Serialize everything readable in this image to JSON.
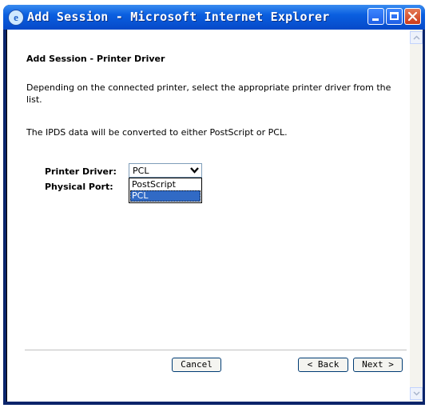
{
  "window": {
    "title": "Add Session - Microsoft Internet Explorer"
  },
  "page": {
    "heading": "Add Session - Printer Driver",
    "instruction": "Depending on the connected printer, select the appropriate printer driver from the list.",
    "conversion_note": "The IPDS data will be converted to either PostScript or PCL."
  },
  "form": {
    "printer_driver_label": "Printer Driver:",
    "physical_port_label": "Physical Port:",
    "printer_driver_selected": "PCL",
    "printer_driver_options": [
      "PostScript",
      "PCL"
    ]
  },
  "buttons": {
    "cancel": "Cancel",
    "back": "< Back",
    "next": "Next >"
  },
  "icons": {
    "app": "ie-icon",
    "minimize": "minimize-icon",
    "maximize": "maximize-icon",
    "close": "close-icon",
    "dropdown": "chevron-down-icon"
  }
}
